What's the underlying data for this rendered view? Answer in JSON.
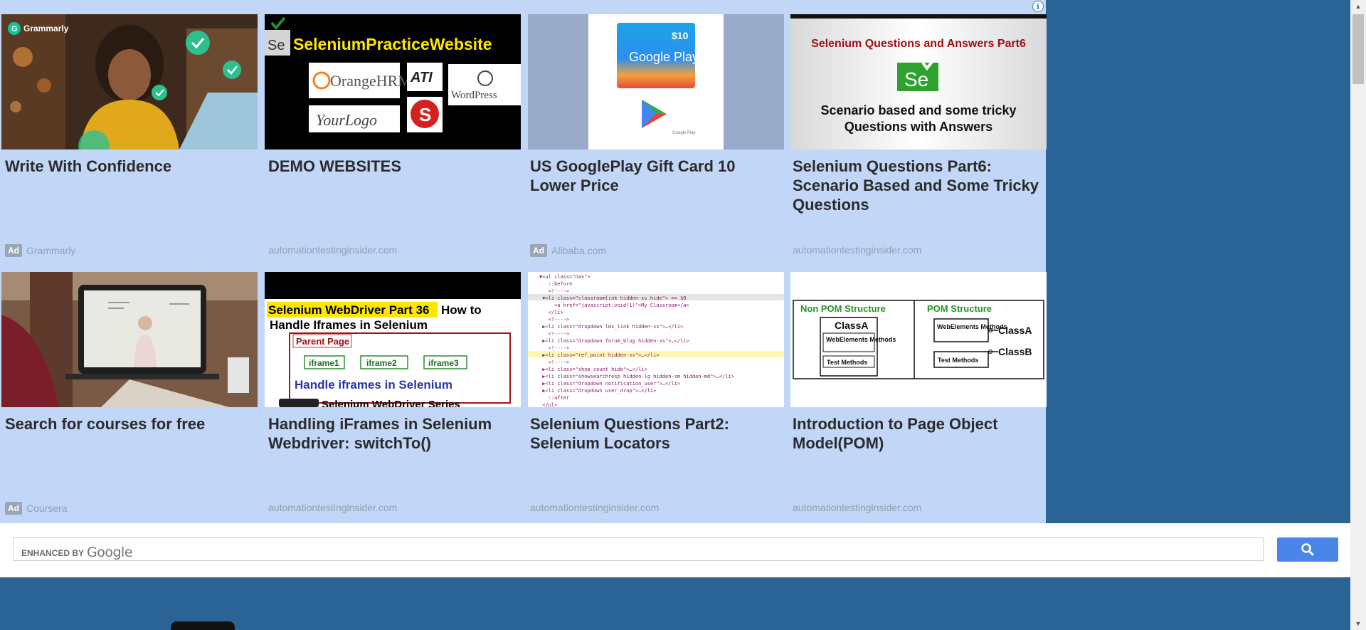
{
  "adchoices_icon": "info-icon",
  "cards": [
    {
      "title": "Write With Confidence",
      "is_ad": true,
      "ad_label": "Ad",
      "source": "Grammarly",
      "thumb": {
        "brand": "grammarly"
      }
    },
    {
      "title": "DEMO WEBSITES",
      "is_ad": false,
      "source": "automationtestinginsider.com",
      "thumb": {
        "banner": "SeleniumPracticeWebsite",
        "logos": [
          "OrangeHRM",
          "ATI",
          "WordPress",
          "YourLogo"
        ],
        "se": "Se"
      }
    },
    {
      "title": "US GooglePlay Gift Card 10 Lower Price",
      "is_ad": true,
      "ad_label": "Ad",
      "source": "Alibaba.com",
      "thumb": {
        "price": "$10",
        "brand": "Google Play",
        "fine": "Google Play"
      }
    },
    {
      "title": "Selenium Questions Part6: Scenario Based and Some Tricky Questions",
      "is_ad": false,
      "source": "automationtestinginsider.com",
      "thumb": {
        "heading": "Selenium Questions and Answers Part6",
        "se": "Se",
        "line1": "Scenario based and some tricky",
        "line2": "Questions with Answers"
      }
    },
    {
      "title": "Search for courses for free",
      "is_ad": true,
      "ad_label": "Ad",
      "source": "Coursera",
      "thumb": {}
    },
    {
      "title": "Handling iFrames in Selenium Webdriver: switchTo()",
      "is_ad": false,
      "source": "automationtestinginsider.com",
      "thumb": {
        "heading_hl": "Selenium WebDriver Part 36",
        "heading_rest": "How to",
        "line2": "Handle Iframes in Selenium",
        "parent": "Parent Page",
        "iframes": [
          "iframe1",
          "iframe2",
          "iframe3"
        ],
        "handle": "Handle iframes in Selenium",
        "series": "Selenium WebDriver Series"
      }
    },
    {
      "title": "Selenium Questions Part2: Selenium Locators",
      "is_ad": false,
      "source": "automationtestinginsider.com",
      "thumb": {
        "code": [
          "▼<ul class=\"nav\">",
          "   ::before",
          "   <!---->",
          " ▼<li class=\"classroomlink hidden-xs hide\"> == $0",
          "     <a href=\"javascript:void(1)\">My Classroom</a>",
          "   </li>",
          "   <!---->",
          " ▶<li class=\"dropdown lms_link hidden-xs\">…</li>",
          "   <!---->",
          " ▶<li class=\"dropdown forum_blog hidden-xs\">…</li>",
          "   <!---->",
          " ▶<li class=\"ref_point hidden-xs\">…</li>",
          "   <!---->",
          " ▶<li class=\"shop_count hide\">…</li>",
          " ▶<li class=\"showsearchresp hidden-lg hidden-sm hidden-md\">…</li>",
          " ▶<li class=\"dropdown notification_user\">…</li>",
          " ▶<li class=\"dropdown user_drop\">…</li>",
          "   ::after",
          " </ul>"
        ]
      }
    },
    {
      "title": "Introduction to Page Object Model(POM)",
      "is_ad": false,
      "source": "automationtestinginsider.com",
      "thumb": {
        "left_title": "Non POM Structure",
        "right_title": "POM Structure",
        "class_a": "ClassA",
        "class_b": "ClassB",
        "web_elements": "WebElements Methods",
        "test_methods": "Test Methods"
      }
    }
  ],
  "search": {
    "enhanced_by": "ENHANCED BY",
    "google": "Google",
    "button_icon": "search-icon"
  }
}
